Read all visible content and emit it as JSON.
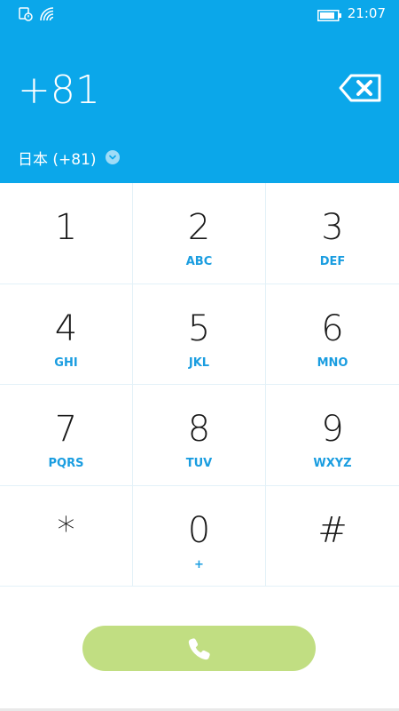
{
  "status_bar": {
    "time": "21:07",
    "icons": [
      "notification-icon",
      "wifi-icon",
      "battery-icon"
    ]
  },
  "dialer": {
    "number": "+81",
    "country": "日本 (+81)"
  },
  "keypad": {
    "keys": [
      {
        "digit": "1",
        "letters": ""
      },
      {
        "digit": "2",
        "letters": "ABC"
      },
      {
        "digit": "3",
        "letters": "DEF"
      },
      {
        "digit": "4",
        "letters": "GHI"
      },
      {
        "digit": "5",
        "letters": "JKL"
      },
      {
        "digit": "6",
        "letters": "MNO"
      },
      {
        "digit": "7",
        "letters": "PQRS"
      },
      {
        "digit": "8",
        "letters": "TUV"
      },
      {
        "digit": "9",
        "letters": "WXYZ"
      },
      {
        "digit": "*",
        "letters": ""
      },
      {
        "digit": "0",
        "letters": "+"
      },
      {
        "digit": "#",
        "letters": ""
      }
    ]
  },
  "colors": {
    "header_bg": "#0ba7ea",
    "letters": "#1a9de0",
    "call_button": "#c1de82"
  },
  "icons": {
    "backspace": "backspace-icon",
    "country_dropdown": "chevron-down-icon",
    "call": "phone-icon"
  }
}
